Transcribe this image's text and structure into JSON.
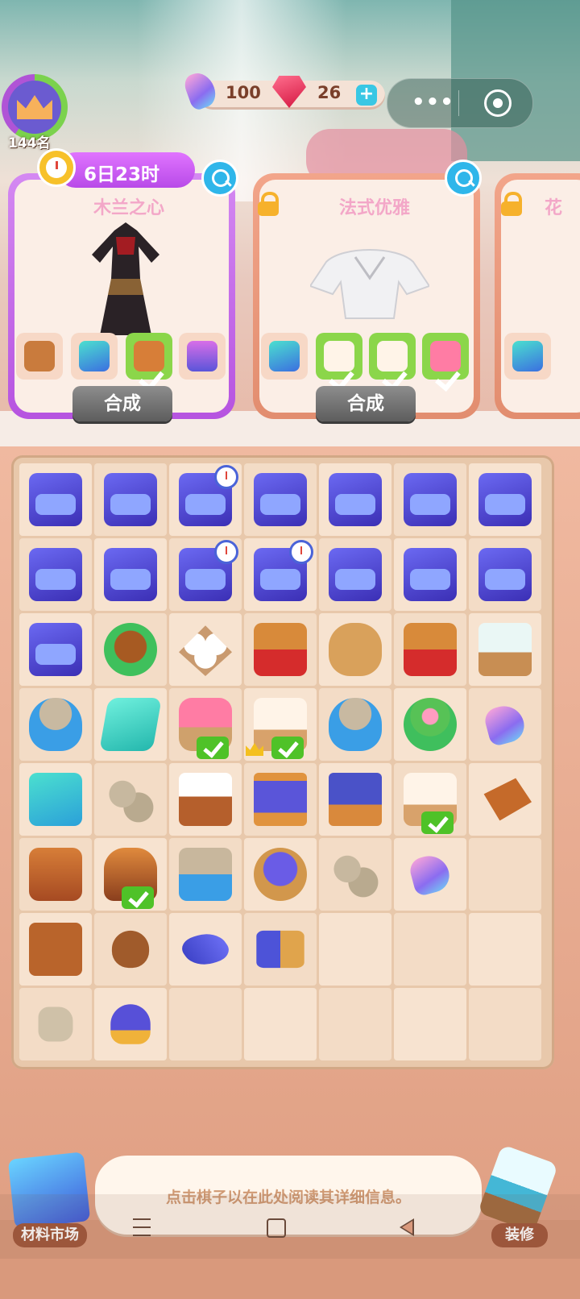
{
  "player": {
    "rank": "144名"
  },
  "currency": {
    "feathers": "100",
    "gems": "26",
    "add": "+"
  },
  "timer": {
    "text": "6日23时"
  },
  "outfits": [
    {
      "title": "木兰之心",
      "button": "合成",
      "locked": false
    },
    {
      "title": "法式优雅",
      "button": "合成",
      "locked": true
    },
    {
      "title": "花",
      "locked": true
    }
  ],
  "bottom": {
    "hint": "点击棋子以在此处阅读其详细信息。",
    "market_label": "材料市场",
    "renovate_label": "装修"
  },
  "board": {
    "rows": 8,
    "cols": 7,
    "items": [
      [
        "sewing-kit",
        "sewing-kit",
        "sewing-kit-timer",
        "sewing-kit",
        "sewing-kit",
        "sewing-kit",
        "sewing-kit"
      ],
      [
        "sewing-kit",
        "sewing-kit",
        "sewing-kit-timer",
        "sewing-kit-timer",
        "sewing-kit",
        "sewing-kit",
        "sewing-kit"
      ],
      [
        "sewing-kit",
        "seed-pot",
        "cotton",
        "logs-cart",
        "sack",
        "logs-cart",
        "sprout-box"
      ],
      [
        "rock-bucket",
        "teal-cloth",
        "sewing-machine-check",
        "towels-crown-check",
        "rock-bucket",
        "flower-pot",
        "feather"
      ],
      [
        "cloth-pile",
        "stones",
        "cotton-crate",
        "loom",
        "spool-stand",
        "towel-roll-check",
        "leather"
      ],
      [
        "log-pile",
        "log-bucket-check",
        "stone-cart",
        "yarn-basket",
        "stones",
        "feather",
        ""
      ],
      [
        "leather-sheet",
        "seed",
        "thread",
        "spools",
        "",
        "",
        ""
      ],
      [
        "stone",
        "pincushion",
        "",
        "",
        "",
        "",
        ""
      ]
    ]
  }
}
